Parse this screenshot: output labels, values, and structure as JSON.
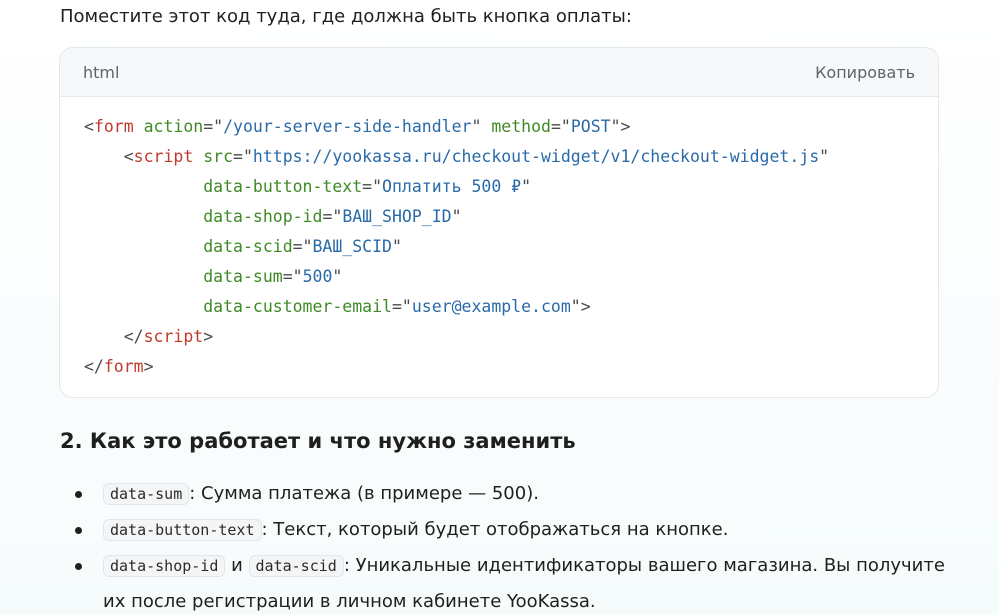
{
  "intro": "Поместите этот код туда, где должна быть кнопка оплаты:",
  "code_block": {
    "language": "html",
    "copy_label": "Копировать",
    "lines": [
      [
        {
          "c": "p",
          "t": "<"
        },
        {
          "c": "t",
          "t": "form"
        },
        {
          "c": "p",
          "t": " "
        },
        {
          "c": "a",
          "t": "action"
        },
        {
          "c": "p",
          "t": "=\""
        },
        {
          "c": "s",
          "t": "/your-server-side-handler"
        },
        {
          "c": "p",
          "t": "\" "
        },
        {
          "c": "a",
          "t": "method"
        },
        {
          "c": "p",
          "t": "=\""
        },
        {
          "c": "s",
          "t": "POST"
        },
        {
          "c": "p",
          "t": "\">"
        }
      ],
      [
        {
          "c": "p",
          "t": "    <"
        },
        {
          "c": "t",
          "t": "script"
        },
        {
          "c": "p",
          "t": " "
        },
        {
          "c": "a",
          "t": "src"
        },
        {
          "c": "p",
          "t": "=\""
        },
        {
          "c": "s",
          "t": "https://yookassa.ru/checkout-widget/v1/checkout-widget.js"
        },
        {
          "c": "p",
          "t": "\""
        }
      ],
      [
        {
          "c": "p",
          "t": "            "
        },
        {
          "c": "a",
          "t": "data-button-text"
        },
        {
          "c": "p",
          "t": "=\""
        },
        {
          "c": "s",
          "t": "Оплатить 500 ₽"
        },
        {
          "c": "p",
          "t": "\""
        }
      ],
      [
        {
          "c": "p",
          "t": "            "
        },
        {
          "c": "a",
          "t": "data-shop-id"
        },
        {
          "c": "p",
          "t": "=\""
        },
        {
          "c": "s",
          "t": "ВАШ_SHOP_ID"
        },
        {
          "c": "p",
          "t": "\""
        }
      ],
      [
        {
          "c": "p",
          "t": "            "
        },
        {
          "c": "a",
          "t": "data-scid"
        },
        {
          "c": "p",
          "t": "=\""
        },
        {
          "c": "s",
          "t": "ВАШ_SCID"
        },
        {
          "c": "p",
          "t": "\""
        }
      ],
      [
        {
          "c": "p",
          "t": "            "
        },
        {
          "c": "a",
          "t": "data-sum"
        },
        {
          "c": "p",
          "t": "=\""
        },
        {
          "c": "s",
          "t": "500"
        },
        {
          "c": "p",
          "t": "\""
        }
      ],
      [
        {
          "c": "p",
          "t": "            "
        },
        {
          "c": "a",
          "t": "data-customer-email"
        },
        {
          "c": "p",
          "t": "=\""
        },
        {
          "c": "s",
          "t": "user@example.com"
        },
        {
          "c": "p",
          "t": "\">"
        }
      ],
      [
        {
          "c": "p",
          "t": "    </"
        },
        {
          "c": "t",
          "t": "script"
        },
        {
          "c": "p",
          "t": ">"
        }
      ],
      [
        {
          "c": "p",
          "t": "</"
        },
        {
          "c": "t",
          "t": "form"
        },
        {
          "c": "p",
          "t": ">"
        }
      ]
    ]
  },
  "section": {
    "heading": "2. Как это работает и что нужно заменить",
    "items": [
      {
        "code1": "data-sum",
        "text": ": Сумма платежа (в примере — 500)."
      },
      {
        "code1": "data-button-text",
        "text": ": Текст, который будет отображаться на кнопке."
      },
      {
        "code1": "data-shop-id",
        "mid": " и ",
        "code2": "data-scid",
        "text": ": Уникальные идентификаторы вашего магазина. Вы получите их после регистрации в личном кабинете YooKassa."
      }
    ]
  },
  "colors": {
    "tag": "#c0392b",
    "attribute": "#3f8a25",
    "string": "#2a6aa8",
    "punctuation": "#4a4a4a"
  }
}
